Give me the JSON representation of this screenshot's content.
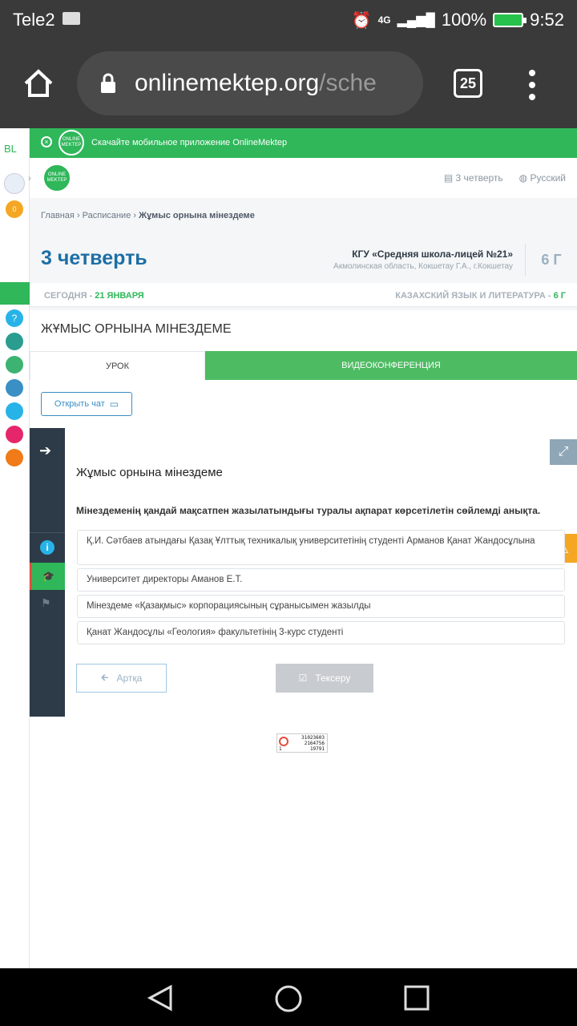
{
  "status": {
    "carrier": "Tele2",
    "net": "4G",
    "battery": "100%",
    "time": "9:52"
  },
  "browser": {
    "url_main": "onlinemektep.org",
    "url_rest": "/sche",
    "tabs": "25"
  },
  "rail": {
    "badge": "0"
  },
  "promo": {
    "logo": "ONLINE MEKTEP",
    "text": "Скачайте мобильное приложение OnlineMektep"
  },
  "header": {
    "logo": "ONLINE MEKTEP",
    "quarter_link": "3 четверть",
    "lang": "Русский"
  },
  "breadcrumb": {
    "home": "Главная",
    "schedule": "Расписание",
    "current": "Жұмыс орнына мінездеме"
  },
  "hero": {
    "quarter": "3 четверть",
    "school": "КГУ «Средняя школа-лицей №21»",
    "address": "Акмолинская область, Кокшетау Г.А., г.Кокшетау",
    "grade": "6 Г"
  },
  "todaybar": {
    "today_label": "СЕГОДНЯ - ",
    "today_date": "21 ЯНВАРЯ",
    "subject": "КАЗАХСКИЙ ЯЗЫК И ЛИТЕРАТУРА - ",
    "subject_grade": "6 Г"
  },
  "lesson_title": "ЖҰМЫС ОРНЫНА МІНЕЗДЕМЕ",
  "tabs": {
    "lesson": "УРОК",
    "video": "ВИДЕОКОНФЕРЕНЦИЯ"
  },
  "chat": {
    "label": "Открыть чат"
  },
  "quiz": {
    "title": "Жұмыс орнына мінездеме",
    "question": "Мінездеменің қандай мақсатпен жазылатындығы туралы ақпарат көрсетілетін сөйлемді анықта.",
    "options": [
      "Қ.И. Сәтбаев атындағы Қазақ Ұлттық техникалық университетінің студенті Арманов Қанат Жандосұлына",
      "Университет директоры Аманов Е.Т.",
      "Мінездеме «Қазақмыс» корпорациясының сұранысымен жазылды",
      "Қанат Жандосұлы «Геология» факультетінің 3-курс студенті"
    ],
    "back": "Артқа",
    "check": "Тексеру"
  },
  "counter": {
    "l1": "31023603",
    "l2": "2164756",
    "l3a": "1",
    "l3b": "19791"
  }
}
